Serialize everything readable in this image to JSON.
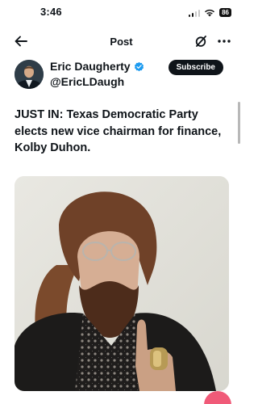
{
  "status_bar": {
    "time": "3:46",
    "battery": "86"
  },
  "nav": {
    "title": "Post"
  },
  "author": {
    "name": "Eric Daugherty",
    "handle": "@EricLDaugh",
    "verified": true
  },
  "actions": {
    "subscribe_label": "Subscribe"
  },
  "post": {
    "text": "JUST IN: Texas Democratic Party elects new vice chairman for finance, Kolby Duhon."
  },
  "icons": [
    "back-arrow-icon",
    "grok-icon",
    "more-icon",
    "verified-icon",
    "signal-icon",
    "wifi-icon",
    "battery-icon"
  ],
  "colors": {
    "accent": "#1d9bf0",
    "subscribe_bg": "#0f1419",
    "fab": "#f05a78"
  }
}
